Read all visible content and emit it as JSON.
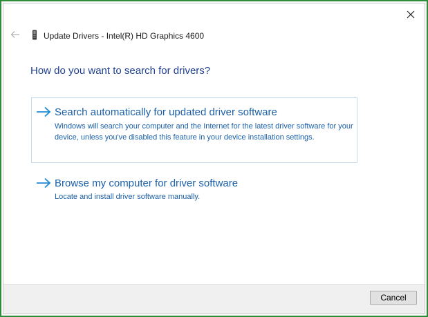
{
  "window": {
    "title": "Update Drivers - Intel(R) HD Graphics 4600",
    "icons": {
      "close": "close-icon",
      "back": "back-arrow-icon",
      "device": "graphics-card-icon"
    }
  },
  "main": {
    "heading": "How do you want to search for drivers?",
    "options": [
      {
        "title": "Search automatically for updated driver software",
        "description": "Windows will search your computer and the Internet for the latest driver software for your device, unless you've disabled this feature in your device installation settings.",
        "icon": "arrow-right-icon"
      },
      {
        "title": "Browse my computer for driver software",
        "description": "Locate and install driver software manually.",
        "icon": "arrow-right-icon"
      }
    ]
  },
  "footer": {
    "cancel_label": "Cancel"
  },
  "colors": {
    "frame_border": "#2e8b3a",
    "heading": "#1f3f8f",
    "link": "#1a5fa8",
    "arrow": "#1e88d4",
    "option_border": "#c6dcee",
    "footer_bg": "#f0f0f0"
  }
}
